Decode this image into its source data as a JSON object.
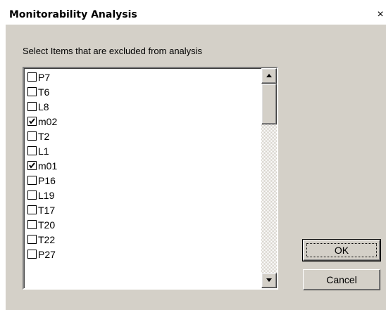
{
  "window": {
    "title": "Monitorability Analysis",
    "close_glyph": "×"
  },
  "instruction": "Select Items that are excluded from analysis",
  "items": [
    {
      "label": "P7",
      "checked": false
    },
    {
      "label": "T6",
      "checked": false
    },
    {
      "label": "L8",
      "checked": false
    },
    {
      "label": "m02",
      "checked": true
    },
    {
      "label": "T2",
      "checked": false
    },
    {
      "label": "L1",
      "checked": false
    },
    {
      "label": "m01",
      "checked": true
    },
    {
      "label": "P16",
      "checked": false
    },
    {
      "label": "L19",
      "checked": false
    },
    {
      "label": "T17",
      "checked": false
    },
    {
      "label": "T20",
      "checked": false
    },
    {
      "label": "T22",
      "checked": false
    },
    {
      "label": "P27",
      "checked": false
    }
  ],
  "buttons": {
    "ok_label": "OK",
    "cancel_label": "Cancel"
  },
  "icons": {
    "close": "close-icon",
    "check": "check-icon",
    "scroll_up": "arrow-up-icon",
    "scroll_down": "arrow-down-icon"
  }
}
